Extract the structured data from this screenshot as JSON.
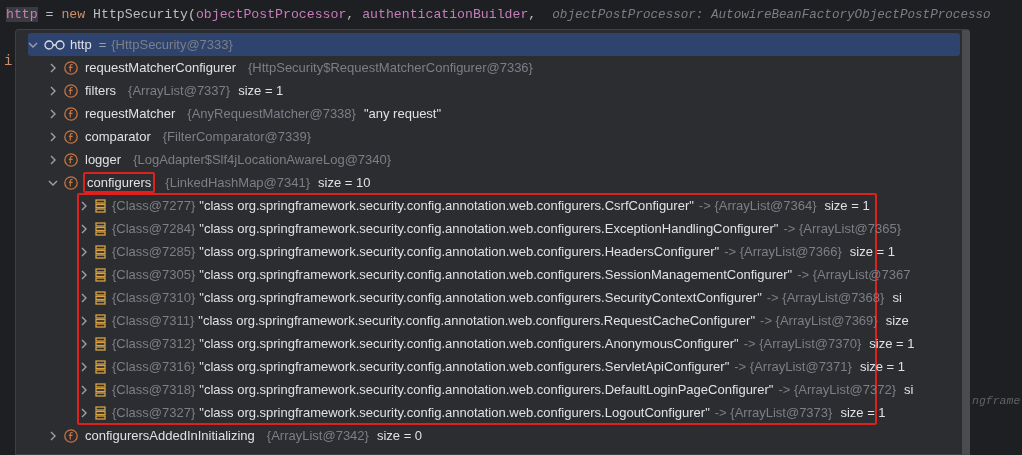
{
  "editor": {
    "code": [
      {
        "text": "http",
        "kind": "highlighted"
      },
      {
        "text": " = ",
        "kind": "plain"
      },
      {
        "text": "new",
        "kind": "keyword"
      },
      {
        "text": " HttpSecurity(",
        "kind": "plain"
      },
      {
        "text": "objectPostProcessor",
        "kind": "param"
      },
      {
        "text": ", ",
        "kind": "plain"
      },
      {
        "text": "authenticationBuilder",
        "kind": "param"
      },
      {
        "text": ",",
        "kind": "plain"
      }
    ],
    "inlay_hint": "objectPostProcessor: AutowireBeanFactoryObjectPostProcesso",
    "margin_text": "i",
    "side_text": "ngframe"
  },
  "variables": {
    "name": "http",
    "equals": "=",
    "ref": "{HttpSecurity@7333}",
    "expanded": true,
    "selected": true,
    "children": [
      {
        "kind": "field",
        "name": "requestMatcherConfigurer",
        "ref": "{HttpSecurity$RequestMatcherConfigurer@7336}",
        "expanded": false,
        "highlighted": false
      },
      {
        "kind": "field",
        "name": "filters",
        "ref": "{ArrayList@7337}",
        "extra": "size = 1",
        "expanded": false,
        "highlighted": false
      },
      {
        "kind": "field",
        "name": "requestMatcher",
        "ref": "{AnyRequestMatcher@7338}",
        "extra": "\"any request\"",
        "expanded": false,
        "highlighted": false
      },
      {
        "kind": "field",
        "name": "comparator",
        "ref": "{FilterComparator@7339}",
        "expanded": false,
        "highlighted": false
      },
      {
        "kind": "field",
        "name": "logger",
        "ref": "{LogAdapter$Slf4jLocationAwareLog@7340}",
        "expanded": false,
        "highlighted": false
      },
      {
        "kind": "field",
        "name": "configurers",
        "ref": "{LinkedHashMap@7341}",
        "extra": "size = 10",
        "expanded": true,
        "highlighted": true,
        "children_highlighted": true,
        "children": [
          {
            "kind": "entry",
            "name": "{Class@7277}",
            "value": "\"class org.springframework.security.config.annotation.web.configurers.CsrfConfigurer\"",
            "ref": "-> {ArrayList@7364}",
            "extra": "size = 1",
            "expanded": false
          },
          {
            "kind": "entry",
            "name": "{Class@7284}",
            "value": "\"class org.springframework.security.config.annotation.web.configurers.ExceptionHandlingConfigurer\"",
            "ref": "-> {ArrayList@7365}",
            "expanded": false
          },
          {
            "kind": "entry",
            "name": "{Class@7285}",
            "value": "\"class org.springframework.security.config.annotation.web.configurers.HeadersConfigurer\"",
            "ref": "-> {ArrayList@7366}",
            "extra": "size = 1",
            "expanded": false
          },
          {
            "kind": "entry",
            "name": "{Class@7305}",
            "value": "\"class org.springframework.security.config.annotation.web.configurers.SessionManagementConfigurer\"",
            "ref": "-> {ArrayList@7367",
            "expanded": false
          },
          {
            "kind": "entry",
            "name": "{Class@7310}",
            "value": "\"class org.springframework.security.config.annotation.web.configurers.SecurityContextConfigurer\"",
            "ref": "-> {ArrayList@7368}",
            "extra": "si",
            "expanded": false
          },
          {
            "kind": "entry",
            "name": "{Class@7311}",
            "value": "\"class org.springframework.security.config.annotation.web.configurers.RequestCacheConfigurer\"",
            "ref": "-> {ArrayList@7369}",
            "extra": "size",
            "expanded": false
          },
          {
            "kind": "entry",
            "name": "{Class@7312}",
            "value": "\"class org.springframework.security.config.annotation.web.configurers.AnonymousConfigurer\"",
            "ref": "-> {ArrayList@7370}",
            "extra": "size = 1",
            "expanded": false
          },
          {
            "kind": "entry",
            "name": "{Class@7316}",
            "value": "\"class org.springframework.security.config.annotation.web.configurers.ServletApiConfigurer\"",
            "ref": "-> {ArrayList@7371}",
            "extra": "size = 1",
            "expanded": false
          },
          {
            "kind": "entry",
            "name": "{Class@7318}",
            "value": "\"class org.springframework.security.config.annotation.web.configurers.DefaultLoginPageConfigurer\"",
            "ref": "-> {ArrayList@7372}",
            "extra": "si",
            "expanded": false
          },
          {
            "kind": "entry",
            "name": "{Class@7327}",
            "value": "\"class org.springframework.security.config.annotation.web.configurers.LogoutConfigurer\"",
            "ref": "-> {ArrayList@7373}",
            "extra": "size = 1",
            "expanded": false
          }
        ]
      },
      {
        "kind": "field",
        "name": "configurersAddedInInitializing",
        "ref": "{ArrayList@7342}",
        "extra": "size = 0",
        "expanded": false,
        "highlighted": false
      }
    ]
  }
}
